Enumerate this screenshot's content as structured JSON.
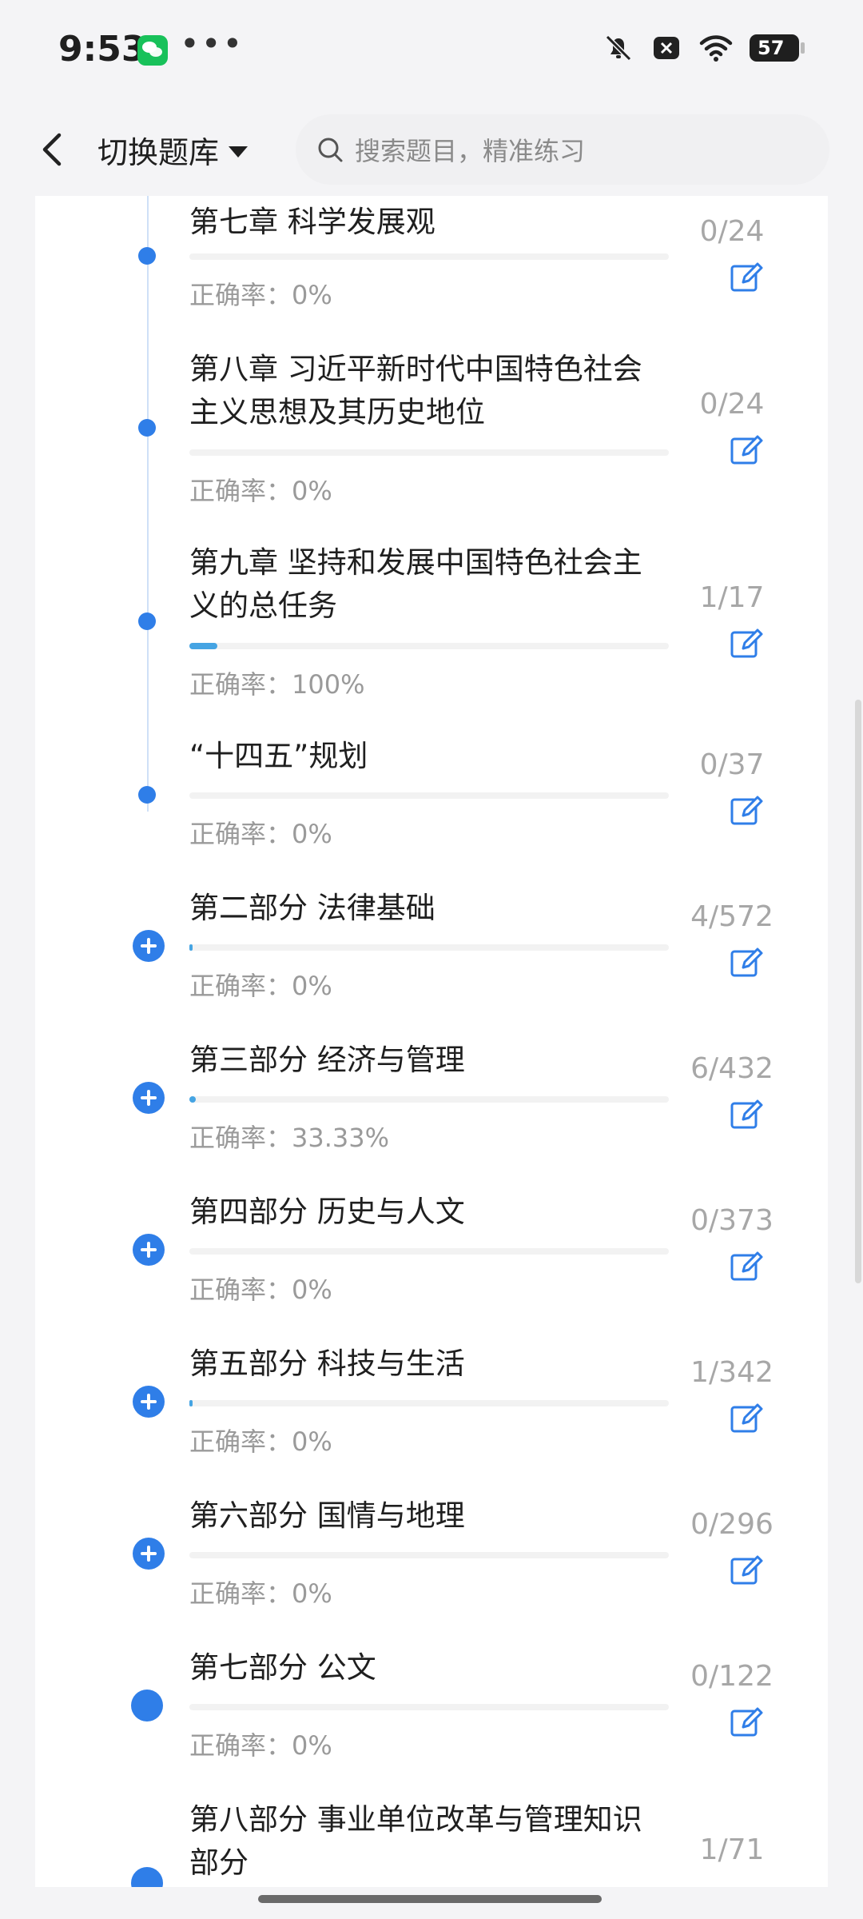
{
  "status_bar": {
    "time": "9:53",
    "dots": "•••",
    "battery": "57"
  },
  "header": {
    "switch_label": "切换题库",
    "search_placeholder": "搜索题目，精准练习"
  },
  "accuracy_prefix": "正确率：",
  "colors": {
    "accent": "#2f7ee8",
    "progress": "#45a4e3",
    "muted": "#9a9a9a"
  },
  "items": [
    {
      "title": "第七章 科学发展观",
      "count": "0/24",
      "accuracy": "正确率：0%",
      "progress": 0,
      "marker": "dot"
    },
    {
      "title": "第八章 习近平新时代中国特色社会主义思想及其历史地位",
      "count": "0/24",
      "accuracy": "正确率：0%",
      "progress": 0,
      "marker": "dot"
    },
    {
      "title": "第九章 坚持和发展中国特色社会主义的总任务",
      "count": "1/17",
      "accuracy": "正确率：100%",
      "progress": 0.0588,
      "marker": "dot"
    },
    {
      "title": "“十四五”规划",
      "count": "0/37",
      "accuracy": "正确率：0%",
      "progress": 0,
      "marker": "dot"
    },
    {
      "title": "第二部分 法律基础",
      "count": "4/572",
      "accuracy": "正确率：0%",
      "progress": 0.007,
      "marker": "plus"
    },
    {
      "title": "第三部分 经济与管理",
      "count": "6/432",
      "accuracy": "正确率：33.33%",
      "progress": 0.0139,
      "marker": "plus"
    },
    {
      "title": "第四部分 历史与人文",
      "count": "0/373",
      "accuracy": "正确率：0%",
      "progress": 0,
      "marker": "plus"
    },
    {
      "title": "第五部分 科技与生活",
      "count": "1/342",
      "accuracy": "正确率：0%",
      "progress": 0.0029,
      "marker": "plus"
    },
    {
      "title": "第六部分 国情与地理",
      "count": "0/296",
      "accuracy": "正确率：0%",
      "progress": 0,
      "marker": "plus"
    },
    {
      "title": "第七部分 公文",
      "count": "0/122",
      "accuracy": "正确率：0%",
      "progress": 0,
      "marker": "big-dot"
    },
    {
      "title": "第八部分 事业单位改革与管理知识部分",
      "count": "1/71",
      "accuracy": "",
      "progress": 0.014,
      "marker": "big-dot"
    }
  ]
}
